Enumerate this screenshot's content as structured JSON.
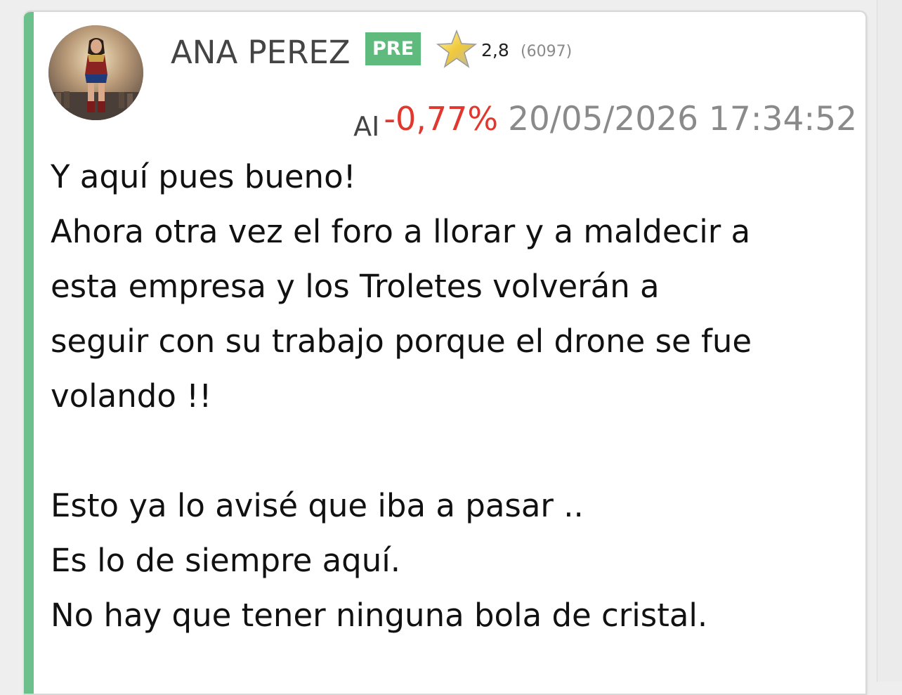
{
  "post": {
    "author": {
      "name": "ANA PEREZ",
      "badge": "PRE",
      "avatar_icon": "user-avatar-photo",
      "rating_icon": "star-icon",
      "rating": "2,8",
      "rating_count": "(6097)"
    },
    "ticker": "AI",
    "change": "-0,77%",
    "timestamp": "20/05/2026 17:34:52",
    "lines": [
      "Y aquí pues bueno!",
      "Ahora otra vez el foro a llorar y a maldecir a",
      "esta empresa y los Troletes volverán a",
      "seguir con su trabajo porque el drone se fue",
      "volando !!",
      "",
      "Esto ya lo avisé que iba a pasar ..",
      "Es lo de siempre aquí.",
      "No hay que tener ninguna bola de cristal."
    ]
  },
  "colors": {
    "accent": "#6cc08b",
    "badge": "#5fba7d",
    "negative_change": "#e0382e",
    "muted_text": "#8a8a8a"
  }
}
